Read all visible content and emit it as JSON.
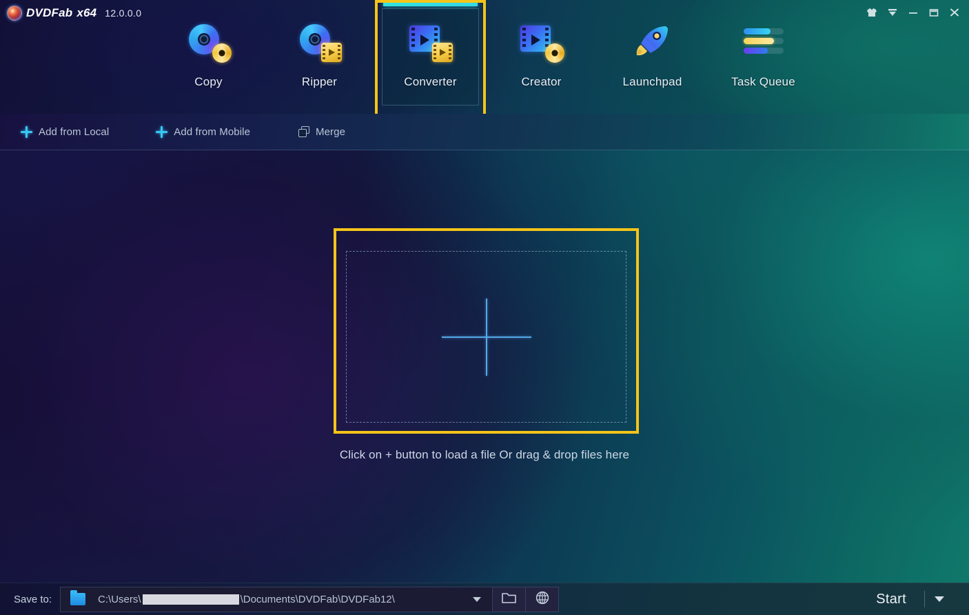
{
  "app": {
    "name": "DVDFab",
    "edition": "x64",
    "version": "12.0.0.0",
    "logo_icon": "dvdfab-orb-logo"
  },
  "window_controls": [
    {
      "name": "theme-shirt-icon",
      "label": "Theme"
    },
    {
      "name": "menu-caret-icon",
      "label": "Menu"
    },
    {
      "name": "minimize-icon",
      "label": "Minimize"
    },
    {
      "name": "maximize-icon",
      "label": "Maximize"
    },
    {
      "name": "close-icon",
      "label": "Close"
    }
  ],
  "tabs": [
    {
      "label": "Copy",
      "icon": "disc-copy-icon",
      "active": false
    },
    {
      "label": "Ripper",
      "icon": "disc-ripper-icon",
      "active": false
    },
    {
      "label": "Converter",
      "icon": "film-converter-icon",
      "active": true
    },
    {
      "label": "Creator",
      "icon": "film-creator-icon",
      "active": false
    },
    {
      "label": "Launchpad",
      "icon": "rocket-icon",
      "active": false
    },
    {
      "label": "Task Queue",
      "icon": "task-queue-bars-icon",
      "active": false
    }
  ],
  "subtoolbar": [
    {
      "label": "Add from Local",
      "icon": "plus-icon"
    },
    {
      "label": "Add from Mobile",
      "icon": "plus-icon"
    },
    {
      "label": "Merge",
      "icon": "merge-icon"
    }
  ],
  "dropzone": {
    "plus_icon": "plus-large-icon",
    "hint": "Click on + button to load a file Or drag & drop files here"
  },
  "bottom": {
    "save_to_label": "Save to:",
    "folder_icon": "folder-blue-icon",
    "path_prefix": "C:\\Users\\",
    "path_suffix": "\\Documents\\DVDFab\\DVDFab12\\",
    "dropdown_icon": "chevron-down-icon",
    "browse_icon": "folder-outline-icon",
    "online_icon": "globe-icon",
    "start_label": "Start",
    "start_caret_icon": "chevron-down-icon"
  },
  "colors": {
    "highlight_box": "#f5c419",
    "active_tab_bar": "#2fe3e0",
    "accent_plus": "#39c8f5",
    "drop_plus": "#54a8e8"
  }
}
